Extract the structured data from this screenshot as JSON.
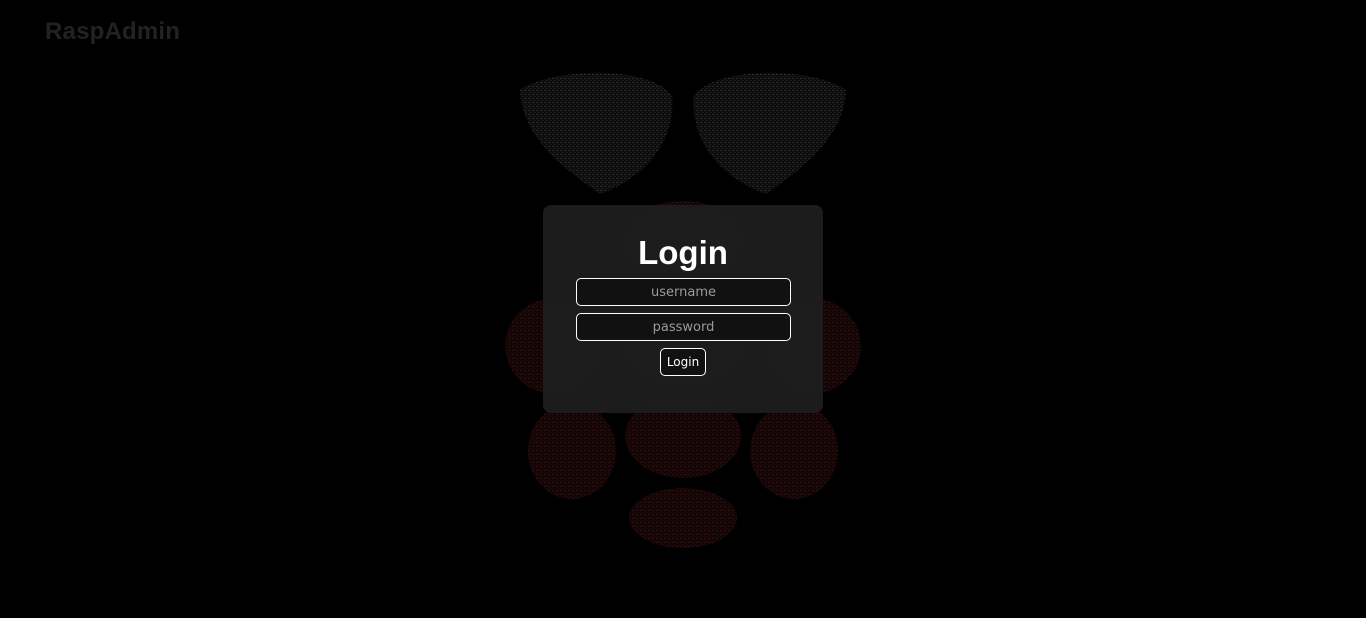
{
  "header": {
    "brand": "RaspAdmin"
  },
  "login": {
    "title": "Login",
    "username_placeholder": "username",
    "password_placeholder": "password",
    "submit_label": "Login"
  },
  "background": {
    "logo_icon": "raspberry-pi-ascii-logo-icon",
    "leaf_color": "#1a1a1a",
    "berry_color": "#2a0a0c"
  },
  "colors": {
    "page_background": "#000000",
    "card_background": "#1e1e1e",
    "text": "#ffffff",
    "brand_text": "#222222",
    "placeholder": "#9a9a9a"
  }
}
